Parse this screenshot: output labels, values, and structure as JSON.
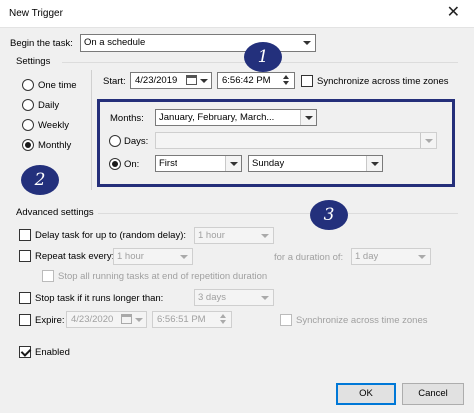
{
  "window": {
    "title": "New Trigger",
    "close_glyph": "✕"
  },
  "begin": {
    "label": "Begin the task:",
    "value": "On a schedule"
  },
  "settings": {
    "label": "Settings",
    "options": [
      "One time",
      "Daily",
      "Weekly",
      "Monthly"
    ],
    "selected": "Monthly",
    "start_label": "Start:",
    "start_date": "4/23/2019",
    "start_time": "6:56:42 PM",
    "sync_label": "Synchronize across time zones"
  },
  "monthly": {
    "months_label": "Months:",
    "months_value": "January, February, March...",
    "days_label": "Days:",
    "days_value": "",
    "on_label": "On:",
    "on_week": "First",
    "on_day": "Sunday"
  },
  "advanced": {
    "label": "Advanced settings",
    "delay_label": "Delay task for up to (random delay):",
    "delay_value": "1 hour",
    "repeat_label": "Repeat task every:",
    "repeat_value": "1 hour",
    "duration_label": "for a duration of:",
    "duration_value": "1 day",
    "stop_running_label": "Stop all running tasks at end of repetition duration",
    "stop_longer_label": "Stop task if it runs longer than:",
    "stop_longer_value": "3 days",
    "expire_label": "Expire:",
    "expire_date": "4/23/2020",
    "expire_time": "6:56:51 PM",
    "expire_sync_label": "Synchronize across time zones",
    "enabled_label": "Enabled"
  },
  "buttons": {
    "ok": "OK",
    "cancel": "Cancel"
  },
  "annotations": [
    "1",
    "2",
    "3"
  ],
  "colors": {
    "annotation": "#23307c",
    "highlight_border": "#252f7a",
    "default_button": "#0078d7"
  }
}
